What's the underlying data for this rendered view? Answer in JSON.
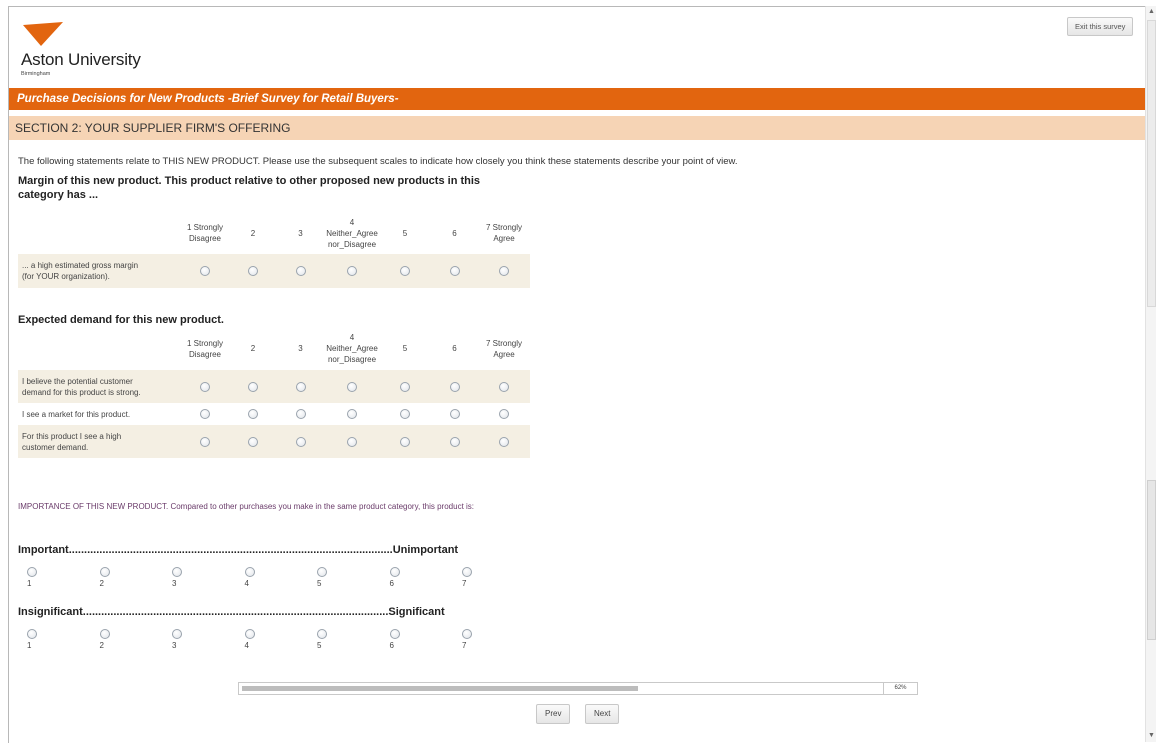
{
  "header": {
    "exit_label": "Exit this survey",
    "logo_name": "Aston University",
    "logo_sub": "Birmingham",
    "brand_color": "#e2650f"
  },
  "survey_title": "Purchase Decisions for New Products -Brief Survey for Retail Buyers-",
  "section_title": "SECTION 2: YOUR SUPPLIER FIRM'S OFFERING",
  "intro": "The following statements relate to THIS NEW PRODUCT. Please use the subsequent scales to indicate how closely you think these statements describe your point of view.",
  "scale_headers": [
    [
      "1 Strongly",
      "Disagree"
    ],
    [
      "2"
    ],
    [
      "3"
    ],
    [
      "4",
      "Neither_Agree",
      "nor_Disagree"
    ],
    [
      "5"
    ],
    [
      "6"
    ],
    [
      "7 Strongly",
      "Agree"
    ]
  ],
  "q1": {
    "title_line1": "Margin of this new product. This product relative to other proposed new products in this",
    "title_line2": "category has ...",
    "rows": [
      {
        "label": [
          "... a high estimated gross margin",
          "(for YOUR organization)."
        ]
      }
    ]
  },
  "q2": {
    "title": "Expected demand for this new product.",
    "rows": [
      {
        "label": [
          "I believe the potential customer",
          "demand for this product is strong."
        ]
      },
      {
        "label": [
          "I see a market for this product."
        ]
      },
      {
        "label": [
          "For this product I see a high",
          "customer demand."
        ]
      }
    ]
  },
  "importance": {
    "text": "IMPORTANCE OF THIS NEW PRODUCT. Compared to other purchases you make in the same product category, this product is:",
    "scales": [
      {
        "left": "Important",
        "right": "Unimportant",
        "options": [
          "1",
          "2",
          "3",
          "4",
          "5",
          "6",
          "7"
        ]
      },
      {
        "left": "Insignificant",
        "right": "Significant",
        "options": [
          "1",
          "2",
          "3",
          "4",
          "5",
          "6",
          "7"
        ]
      }
    ]
  },
  "progress": {
    "label": "62%",
    "fraction": 0.62
  },
  "nav": {
    "prev_label": "Prev",
    "next_label": "Next"
  }
}
